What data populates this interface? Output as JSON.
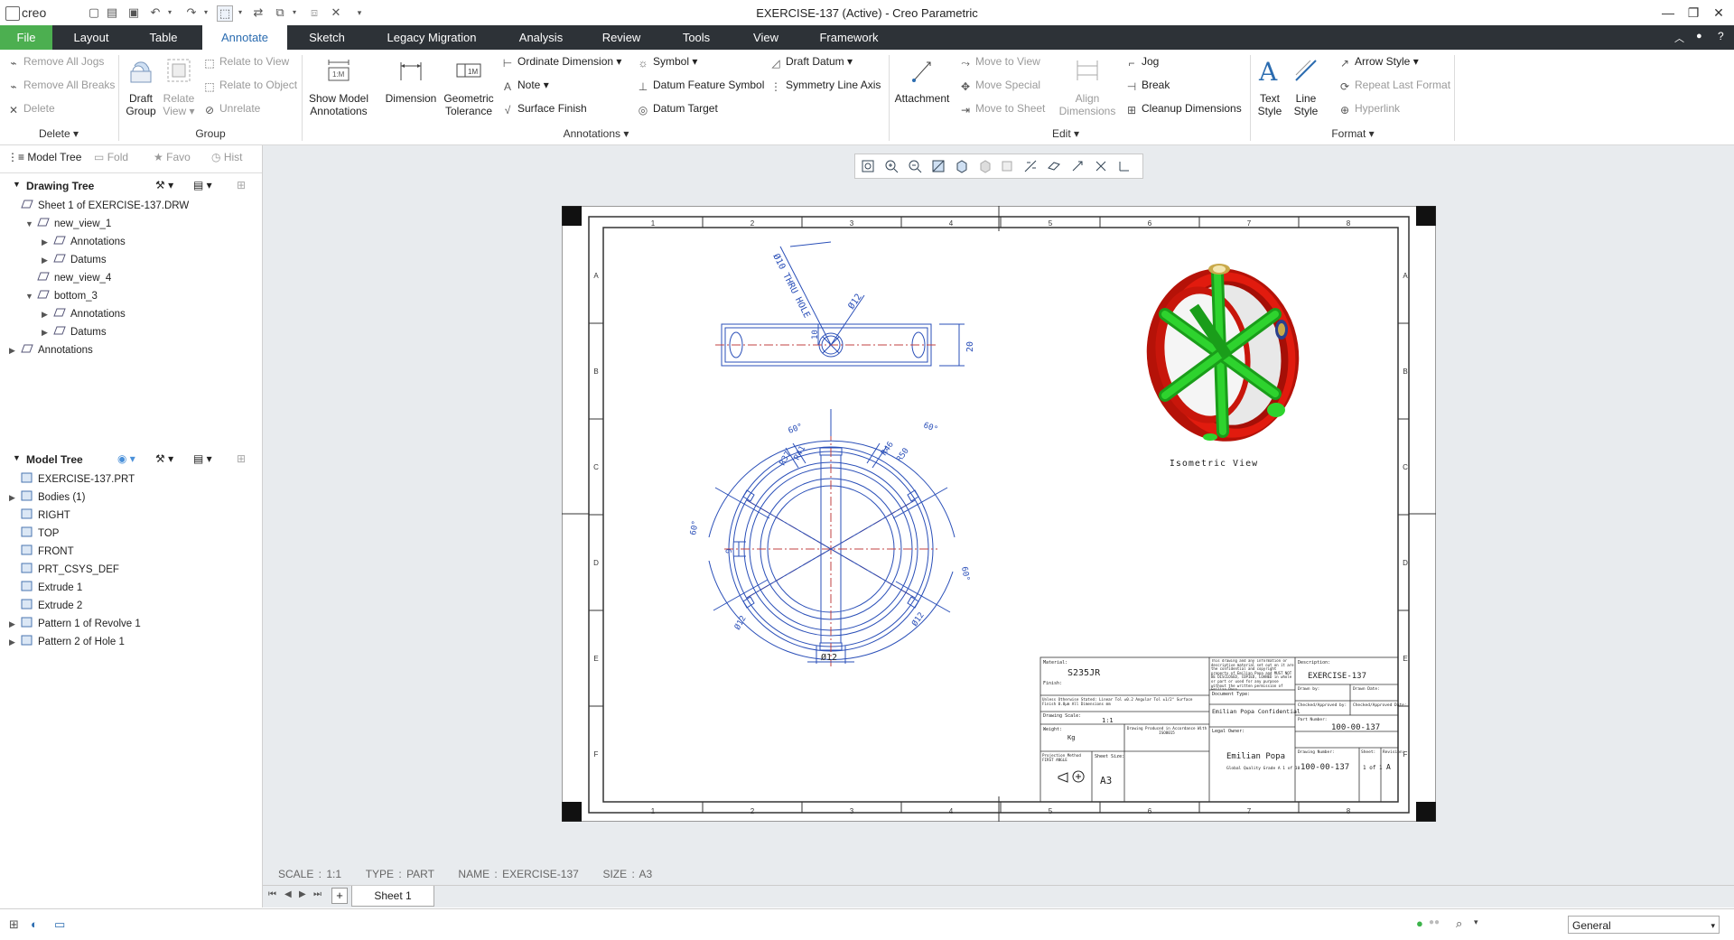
{
  "app": {
    "logo": "creo",
    "window_title": "EXERCISE-137 (Active) - Creo Parametric"
  },
  "menu": {
    "file": "File",
    "tabs": [
      "Layout",
      "Table",
      "Annotate",
      "Sketch",
      "Legacy Migration",
      "Analysis",
      "Review",
      "Tools",
      "View",
      "Framework"
    ],
    "active_tab": "Annotate"
  },
  "ribbon": {
    "delete_group": {
      "items": [
        "Remove All Jogs",
        "Remove All Breaks",
        "Delete"
      ],
      "label": "Delete"
    },
    "group_group": {
      "draft_group": "Draft Group",
      "relate_view": "Relate View",
      "relate_to_view": "Relate to View",
      "relate_to_object": "Relate to Object",
      "unrelate": "Unrelate",
      "label": "Group"
    },
    "annotations_group": {
      "show_model_annotations": "Show Model Annotations",
      "dimension": "Dimension",
      "geometric_tolerance": "Geometric Tolerance",
      "ordinate_dimension": "Ordinate Dimension",
      "note": "Note",
      "surface_finish": "Surface Finish",
      "symbol": "Symbol",
      "datum_feature_symbol": "Datum Feature Symbol",
      "datum_target": "Datum Target",
      "draft_datum": "Draft Datum",
      "symmetry_line_axis": "Symmetry Line Axis",
      "label": "Annotations"
    },
    "edit_group": {
      "attachment": "Attachment",
      "move_to_view": "Move to View",
      "move_special": "Move Special",
      "move_to_sheet": "Move to Sheet",
      "align_dimensions": "Align Dimensions",
      "jog": "Jog",
      "break": "Break",
      "cleanup_dimensions": "Cleanup Dimensions",
      "label": "Edit"
    },
    "format_group": {
      "text_style": "Text Style",
      "line_style": "Line Style",
      "arrow_style": "Arrow Style",
      "repeat_last_format": "Repeat Last Format",
      "hyperlink": "Hyperlink",
      "label": "Format"
    }
  },
  "left_panel": {
    "tabs": [
      "Model Tree",
      "Fold",
      "Favo",
      "Hist"
    ],
    "drawing_tree": {
      "title": "Drawing Tree",
      "items": [
        {
          "label": "Sheet 1 of EXERCISE-137.DRW",
          "indent": 0,
          "toggle": ""
        },
        {
          "label": "new_view_1",
          "indent": 1,
          "toggle": "down"
        },
        {
          "label": "Annotations",
          "indent": 2,
          "toggle": "right"
        },
        {
          "label": "Datums",
          "indent": 2,
          "toggle": "right"
        },
        {
          "label": "new_view_4",
          "indent": 1,
          "toggle": ""
        },
        {
          "label": "bottom_3",
          "indent": 1,
          "toggle": "down"
        },
        {
          "label": "Annotations",
          "indent": 2,
          "toggle": "right"
        },
        {
          "label": "Datums",
          "indent": 2,
          "toggle": "right"
        },
        {
          "label": "Annotations",
          "indent": 0,
          "toggle": "right"
        }
      ]
    },
    "model_tree": {
      "title": "Model Tree",
      "items": [
        {
          "label": "EXERCISE-137.PRT",
          "toggle": ""
        },
        {
          "label": "Bodies (1)",
          "toggle": "right"
        },
        {
          "label": "RIGHT",
          "toggle": ""
        },
        {
          "label": "TOP",
          "toggle": ""
        },
        {
          "label": "FRONT",
          "toggle": ""
        },
        {
          "label": "PRT_CSYS_DEF",
          "toggle": ""
        },
        {
          "label": "Extrude 1",
          "toggle": ""
        },
        {
          "label": "Extrude 2",
          "toggle": ""
        },
        {
          "label": "Pattern 1 of Revolve 1",
          "toggle": "right"
        },
        {
          "label": "Pattern 2 of Hole 1",
          "toggle": "right"
        }
      ]
    }
  },
  "drawing": {
    "zone_numbers": [
      "1",
      "2",
      "3",
      "4",
      "5",
      "6",
      "7",
      "8"
    ],
    "zone_letters": [
      "A",
      "B",
      "C",
      "D",
      "E",
      "F"
    ],
    "top_view_dims": {
      "thru_hole": "Ø10 THRU HOLE",
      "d12": "Ø12",
      "h10": "10",
      "h20": "20"
    },
    "front_view_dims": {
      "a1": "60°",
      "a2": "60°",
      "a3": "60°",
      "a4": "60°",
      "r37": "R37",
      "r41": "R41",
      "r46": "R46",
      "r50": "R50",
      "d9": "9",
      "d12a": "Ø12",
      "d12b": "Ø12",
      "d12c": "Ø12"
    },
    "isometric_label": "Isometric View",
    "title_block": {
      "material_label": "Material:",
      "material": "S235JR",
      "finish_label": "Finish:",
      "tolerances": "Unless Otherwise Stated: Linear Tol ±0.2 Angular Tol ±1/2° Surface Finish 0.8μm All Dimensions mm",
      "drawing_scale_label": "Drawing Scale:",
      "drawing_scale": "1:1",
      "weight_label": "Weight:",
      "weight": "Kg",
      "produced_note": "Drawing Produced in Accordance With  ISO8015",
      "projection_label": "Projection Method FIRST ANGLE",
      "sheet_size_label": "Sheet Size:",
      "sheet_size": "A3",
      "confidential_note": "This drawing and any information or descriptive material set out on it are the confidential and copyright property of Emilian Popa and MUST NOT BE DISCLOSED, COPIED, LOANED in whole or part or used for any purpose without the written permission of Emilian Popa",
      "document_type_label": "Document Type:",
      "document_type": "Emilian Popa Confidential",
      "legal_owner_label": "Legal Owner:",
      "legal_owner": "Emilian Popa",
      "legal_owner_note": "Global Quality Grade A 1 of 10",
      "description_label": "Description:",
      "description": "EXERCISE-137",
      "drawn_by_label": "Drawn by:",
      "drawn_date_label": "Drawn Date:",
      "checked_label": "Checked/Approved by:",
      "checked_date_label": "Checked/Approved Date:",
      "part_number_label": "Part Number:",
      "part_number": "100-00-137",
      "drawing_number_label": "Drawing Number:",
      "drawing_number": "100-00-137",
      "sheet_label": "Sheet:",
      "sheet": "1 of 1",
      "revision_label": "Revision:",
      "revision": "A"
    }
  },
  "status_info": {
    "scale": "SCALE : 1:1",
    "type": "TYPE : PART",
    "name": "NAME : EXERCISE-137",
    "size": "SIZE : A3"
  },
  "sheet_tab": "Sheet 1",
  "bottom": {
    "filter_value": "General"
  },
  "colors": {
    "accent": "#2b6cb0",
    "file_tab": "#4caf50",
    "menubar": "#2d3237",
    "model_red": "#e11b0e",
    "model_green": "#22c122",
    "drawing_line": "#2a4fb8"
  }
}
